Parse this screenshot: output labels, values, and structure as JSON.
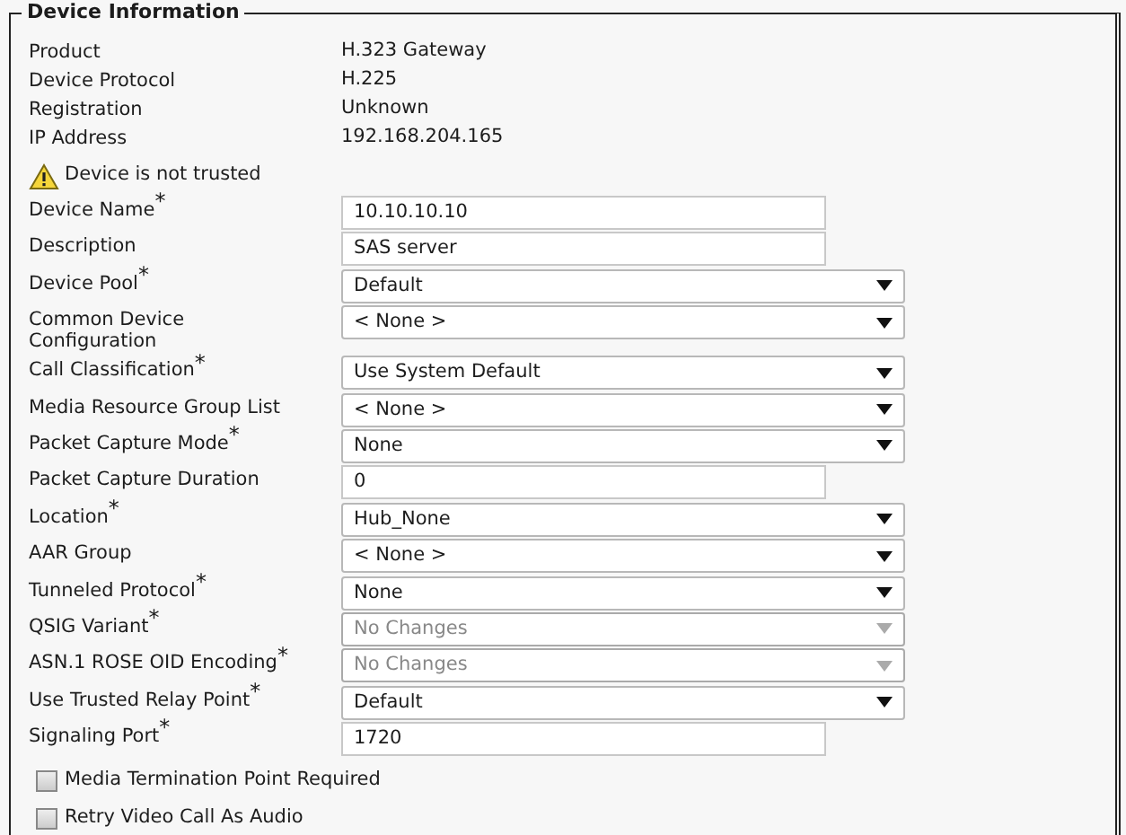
{
  "legend": "Device Information",
  "info": [
    {
      "label": "Product",
      "value": "H.323 Gateway"
    },
    {
      "label": "Device Protocol",
      "value": "H.225"
    },
    {
      "label": "Registration",
      "value": "Unknown"
    },
    {
      "label": "IP Address",
      "value": "192.168.204.165"
    }
  ],
  "warning": {
    "text": "Device is not trusted"
  },
  "fields": [
    {
      "label": "Device Name$^{*}$",
      "kind": "text",
      "value": "10.10.10.10",
      "disabled": false
    },
    {
      "label": "Description",
      "kind": "text",
      "value": "SAS server",
      "disabled": false
    },
    {
      "label": "Device Pool$^{*}$",
      "kind": "select",
      "value": "Default",
      "disabled": false
    },
    {
      "label": "Common Device Configuration",
      "kind": "select",
      "value": "< None >",
      "disabled": false
    },
    {
      "label": "Call Classification$^{*}$",
      "kind": "select",
      "value": "Use System Default",
      "disabled": false
    },
    {
      "label": "Media Resource Group List",
      "kind": "select",
      "value": "< None >",
      "disabled": false
    },
    {
      "label": "Packet Capture Mode$^{*}$",
      "kind": "select",
      "value": "None",
      "disabled": false
    },
    {
      "label": "Packet Capture Duration",
      "kind": "text",
      "value": "0",
      "disabled": false
    },
    {
      "label": "Location$^{*}$",
      "kind": "select",
      "value": "Hub_None",
      "disabled": false
    },
    {
      "label": "AAR Group",
      "kind": "select",
      "value": "< None >",
      "disabled": false
    },
    {
      "label": "Tunneled Protocol$^{*}$",
      "kind": "select",
      "value": "None",
      "disabled": false
    },
    {
      "label": "QSIG Variant$^{*}$",
      "kind": "select",
      "value": "No Changes",
      "disabled": true
    },
    {
      "label": "ASN.1 ROSE OID Encoding$^{*}$",
      "kind": "select",
      "value": "No Changes",
      "disabled": true
    },
    {
      "label": "Use Trusted Relay Point$^{*}$",
      "kind": "select",
      "value": "Default",
      "disabled": false
    },
    {
      "label": "Signaling Port$^{*}$",
      "kind": "text",
      "value": "1720",
      "disabled": false
    }
  ],
  "checkboxes": [
    {
      "label": "Media Termination Point Required",
      "checked": false
    },
    {
      "label": "Retry Video Call As Audio",
      "checked": false
    }
  ]
}
